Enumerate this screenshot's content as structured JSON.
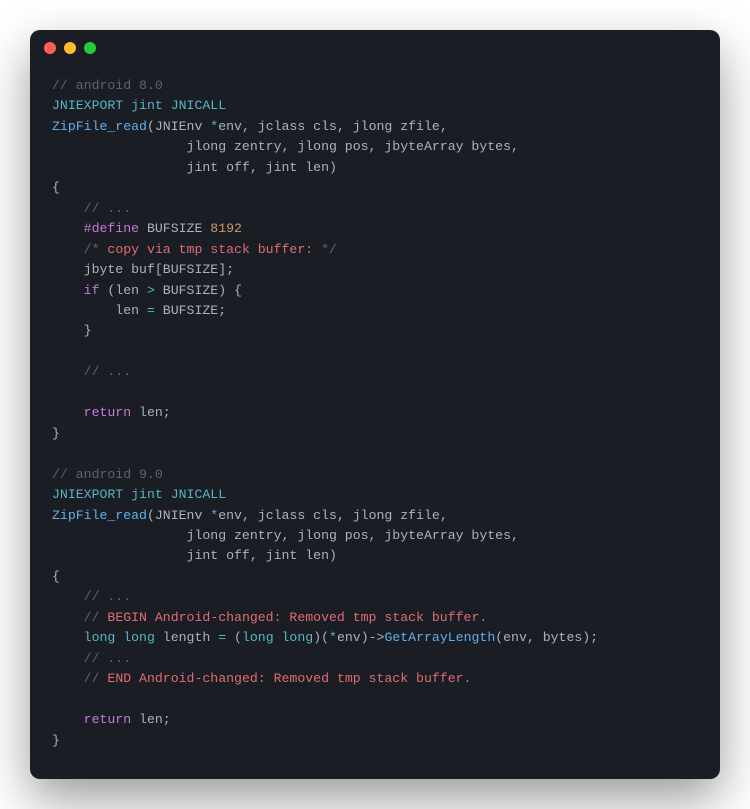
{
  "comment_android8": "// android 8.0",
  "line_export1": "JNIEXPORT jint JNICALL",
  "func_name": "ZipFile_read",
  "sig_part1a": "(JNIEnv ",
  "sig_star": "*",
  "sig_env": "env",
  "sig_comma": ", ",
  "sig_part1b": "jclass cls",
  "sig_part1c": "jlong zfile",
  "sig_line2": "                 jlong zentry, jlong pos, jbyteArray bytes,",
  "sig_line3": "                 jint off, jint len)",
  "brace_open": "{",
  "comment_dots": "    // ...",
  "define_line_kw": "    #define",
  "define_name": " BUFSIZE ",
  "define_val": "8192",
  "copy_comment_open": "    /* ",
  "copy_comment_body": "copy via tmp stack buffer:",
  "copy_comment_close": " */",
  "buf_decl_type": "    jbyte ",
  "buf_decl_name": "buf",
  "buf_decl_bracket": "[BUFSIZE];",
  "if_kw": "    if",
  "if_cond_open": " (len ",
  "if_gt": ">",
  "if_cond_rest": " BUFSIZE) {",
  "if_body": "        len ",
  "if_eq": "=",
  "if_body_rest": " BUFSIZE;",
  "brace_close_indent": "    }",
  "return_kw": "    return",
  "return_var": " len",
  "semi": ";",
  "brace_close": "}",
  "comment_android9": "// android 9.0",
  "begin_comment_slashes": "    // ",
  "begin_comment_body": "BEGIN Android-changed: Removed tmp stack buffer.",
  "long_line_types": "    long long ",
  "long_var": "length",
  "long_eq": " = ",
  "long_cast_open": "(",
  "long_cast_type": "long long",
  "long_cast_close": ")(",
  "long_deref": "*",
  "long_env": "env",
  "long_arrow": ")->",
  "long_call": "GetArrayLength",
  "long_args": "(env, bytes);",
  "end_comment_body": "END Android-changed: Removed tmp stack buffer."
}
